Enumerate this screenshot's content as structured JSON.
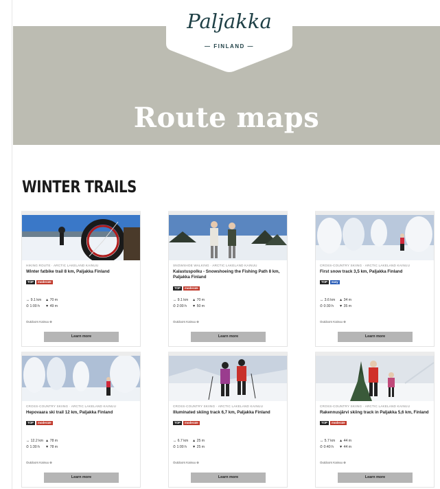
{
  "logo": {
    "text": "Paljakka",
    "sub": "— FINLAND —"
  },
  "hero": {
    "title": "Route maps"
  },
  "section": {
    "title": "WINTER TRAILS"
  },
  "colors": {
    "hero_bg": "#bcbcb2",
    "logo_ink": "#1e3f45",
    "tag_moderate": "#c0392b",
    "tag_easy": "#2c5fb8",
    "button_bg": "#b5b5b5"
  },
  "cards": [
    {
      "category": "HIKING ROUTE · ARCTIC LAKELAND KAINUU",
      "name": "Winter fatbike trail 8 km, Paljakka Finland",
      "tag_top": "TOP",
      "tag_level": "moderate",
      "length": "↔ 9.1 km",
      "ascent": "▲ 70 m",
      "time": "⏱ 1:00 h",
      "descent": "▼ 49 m",
      "source": "Outdoors Kainuu ⊕",
      "button": "Learn more",
      "photo": "fatbike-photo"
    },
    {
      "category": "SNOWSHOE WALKING · ARCTIC LAKELAND KAINUU",
      "name": "Kalastuspolku - Snowshoeing the Fishing Path 8 km, Paljakka Finland",
      "tag_top": "TOP",
      "tag_level": "moderate",
      "length": "↔ 9.1 km",
      "ascent": "▲ 70 m",
      "time": "⏱ 2:00 h",
      "descent": "▼ 50 m",
      "source": "Outdoors Kainuu ⊕",
      "button": "Learn more",
      "photo": "snowshoe-photo"
    },
    {
      "category": "CROSS-COUNTRY SKIING · ARCTIC LAKELAND KAINUU",
      "name": "First snow track 3,5 km, Paljakka Finland",
      "tag_top": "TOP",
      "tag_level": "easy",
      "length": "↔ 3.6 km",
      "ascent": "▲ 34 m",
      "time": "⏱ 0:30 h",
      "descent": "▼ 35 m",
      "source": "Outdoors Kainuu ⊕",
      "button": "Learn more",
      "photo": "snowy-forest-skier-photo"
    },
    {
      "category": "CROSS-COUNTRY SKIING · ARCTIC LAKELAND KAINUU",
      "name": "Hepovaara ski trail 12 km, Paljakka Finland",
      "tag_top": "TOP",
      "tag_level": "moderate",
      "length": "↔ 12.2 km",
      "ascent": "▲ 78 m",
      "time": "⏱ 1:30 h",
      "descent": "▼ 78 m",
      "source": "Outdoors Kainuu ⊕",
      "button": "Learn more",
      "photo": "hepovaara-photo"
    },
    {
      "category": "CROSS-COUNTRY SKIING · ARCTIC LAKELAND KAINUU",
      "name": "Illuminated skiing track 6,7 km, Paljakka Finland",
      "tag_top": "TOP",
      "tag_level": "moderate",
      "length": "↔ 6.7 km",
      "ascent": "▲ 25 m",
      "time": "⏱ 1:00 h",
      "descent": "▼ 25 m",
      "source": "Outdoors Kainuu ⊕",
      "button": "Learn more",
      "photo": "two-skiers-photo"
    },
    {
      "category": "CROSS-COUNTRY SKIING · ARCTIC LAKELAND KAINUU",
      "name": "Rakennusjärvi skiing track in Paljakka 5,6 km, Finland",
      "tag_top": "TOP",
      "tag_level": "moderate",
      "length": "↔ 5.7 km",
      "ascent": "▲ 44 m",
      "time": "⏱ 0:40 h",
      "descent": "▼ 44 m",
      "source": "Outdoors Kainuu ⊕",
      "button": "Learn more",
      "photo": "skiers-spruce-photo"
    }
  ]
}
